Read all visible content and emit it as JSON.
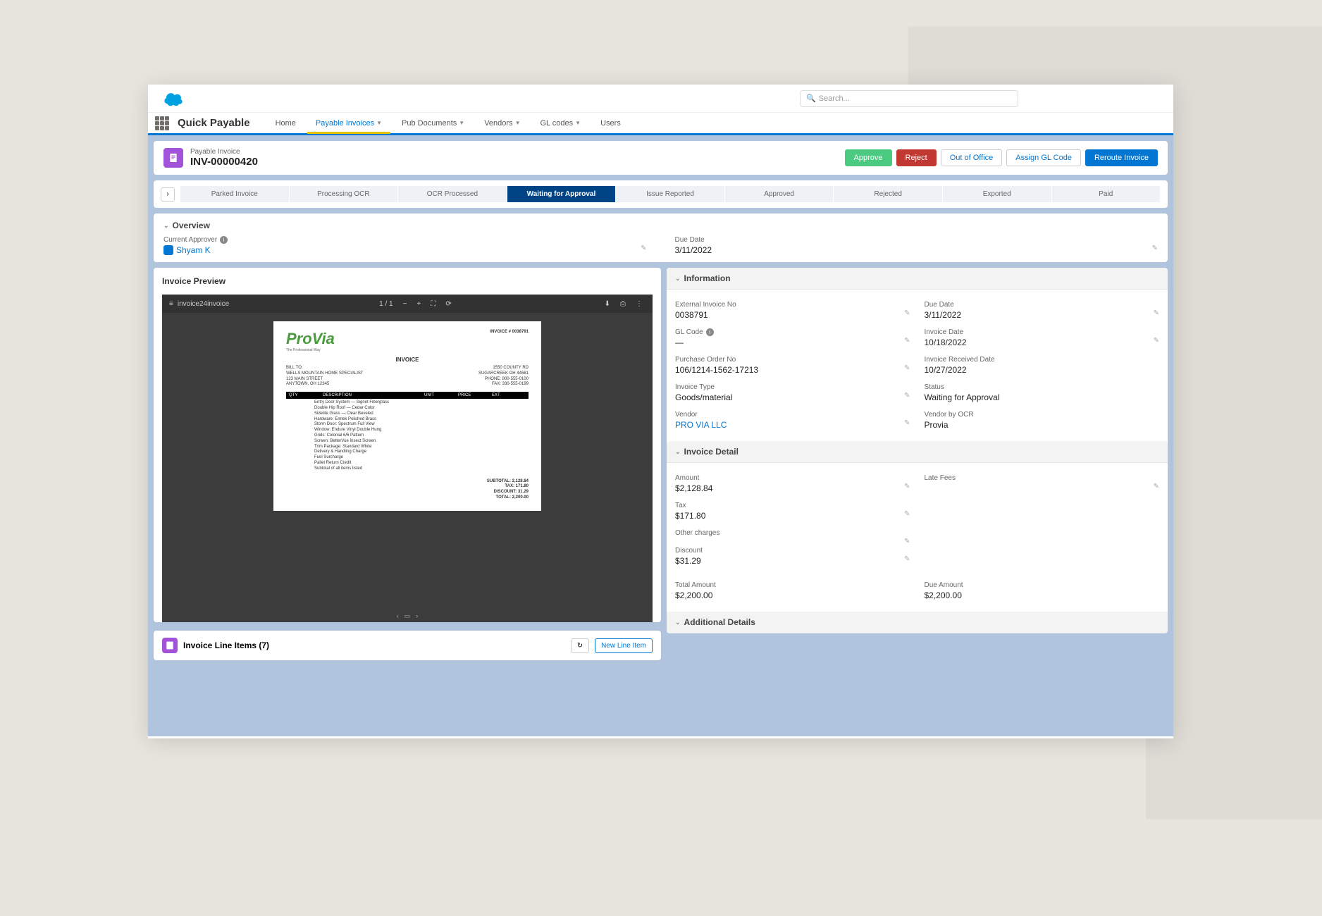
{
  "header": {
    "search_placeholder": "Search..."
  },
  "nav": {
    "app_name": "Quick Payable",
    "tabs": [
      "Home",
      "Payable Invoices",
      "Pub Documents",
      "Vendors",
      "GL codes",
      "Users"
    ],
    "active_index": 1
  },
  "record": {
    "type": "Payable Invoice",
    "title": "INV-00000420",
    "buttons": {
      "approve": "Approve",
      "reject": "Reject",
      "out_of_office": "Out of Office",
      "assign_gl": "Assign GL Code",
      "reroute": "Reroute Invoice"
    }
  },
  "path": {
    "stages": [
      "Parked Invoice",
      "Processing OCR",
      "OCR Processed",
      "Waiting for Approval",
      "Issue Reported",
      "Approved",
      "Rejected",
      "Exported",
      "Paid"
    ],
    "current_index": 3
  },
  "overview": {
    "title": "Overview",
    "current_approver_label": "Current Approver",
    "current_approver_value": "Shyam K",
    "due_date_label": "Due Date",
    "due_date_value": "3/11/2022"
  },
  "preview": {
    "title": "Invoice Preview",
    "filename": "invoice24invoice",
    "page_indicator": "1 / 1",
    "logo_text": "ProVia",
    "logo_sub": "The Professional Way",
    "doc_type": "INVOICE",
    "header_right": "INVOICE # 0038791",
    "bill_to": "BILL TO:\nWELLS MOUNTAIN HOME SPECIALIST\n123 MAIN STREET\nANYTOWN, OH 12345",
    "addr_right": "1550 COUNTY RD\nSUGARCREEK OH 44681\nPHONE: 800-555-0100\nFAX: 330-555-0199",
    "table_headers": [
      "QTY",
      "DESCRIPTION",
      "UNIT",
      "PRICE",
      "EXT"
    ],
    "lines_text": "Entry Door System — Signet Fiberglass\nDouble Hip Roof — Cedar Color\nSidelite Glass — Clear Beveled\nHardware: Emtek Polished Brass\nStorm Door: Spectrum Full View\nWindow: Endure Vinyl Double Hung\nGrids: Colonial 6/6 Pattern\nScreen: BetterVue Insect Screen\nTrim Package: Standard White\nDelivery & Handling Charge\nFuel Surcharge\nPallet Return Credit\nSubtotal of all items listed",
    "totals": "SUBTOTAL: 2,128.84\nTAX: 171.80\nDISCOUNT: 31.29\nTOTAL: 2,200.00"
  },
  "information": {
    "title": "Information",
    "external_invoice_label": "External Invoice No",
    "external_invoice_value": "0038791",
    "due_date_label": "Due Date",
    "due_date_value": "3/11/2022",
    "gl_code_label": "GL Code",
    "gl_code_value": "—",
    "invoice_date_label": "Invoice Date",
    "invoice_date_value": "10/18/2022",
    "po_label": "Purchase Order No",
    "po_value": "106/1214-1562-17213",
    "received_label": "Invoice Received Date",
    "received_value": "10/27/2022",
    "type_label": "Invoice Type",
    "type_value": "Goods/material",
    "status_label": "Status",
    "status_value": "Waiting for Approval",
    "vendor_label": "Vendor",
    "vendor_value": "PRO VIA LLC",
    "vendor_ocr_label": "Vendor by OCR",
    "vendor_ocr_value": "Provia"
  },
  "detail": {
    "title": "Invoice Detail",
    "amount_label": "Amount",
    "amount_value": "$2,128.84",
    "late_fees_label": "Late Fees",
    "late_fees_value": "",
    "tax_label": "Tax",
    "tax_value": "$171.80",
    "other_label": "Other charges",
    "other_value": "",
    "discount_label": "Discount",
    "discount_value": "$31.29",
    "total_label": "Total Amount",
    "total_value": "$2,200.00",
    "due_amount_label": "Due Amount",
    "due_amount_value": "$2,200.00"
  },
  "additional": {
    "title": "Additional Details"
  },
  "line_items": {
    "title": "Invoice Line Items (7)",
    "refresh": "↻",
    "new_btn": "New Line Item"
  }
}
